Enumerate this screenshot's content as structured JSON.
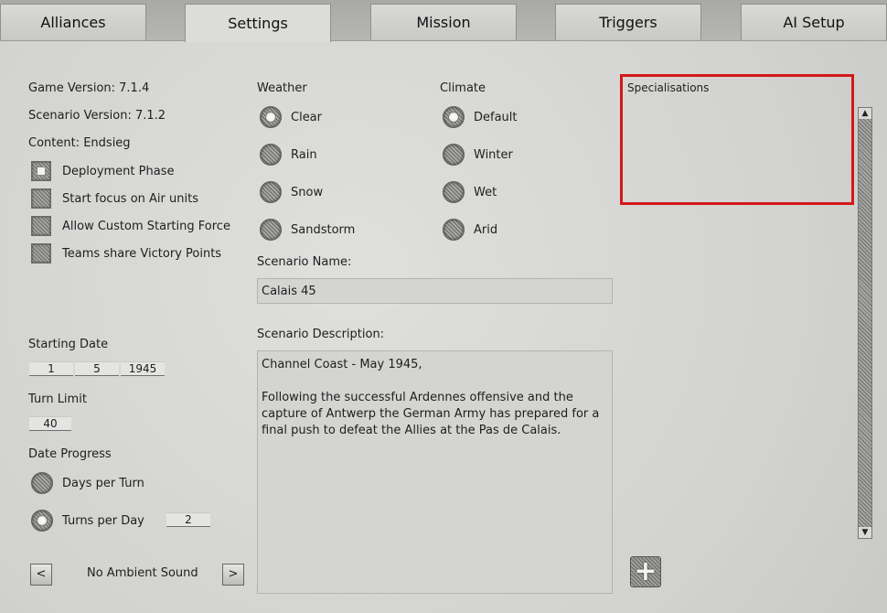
{
  "tabs": [
    {
      "label": "Alliances"
    },
    {
      "label": "Settings"
    },
    {
      "label": "Mission"
    },
    {
      "label": "Triggers"
    },
    {
      "label": "AI Setup"
    }
  ],
  "info": {
    "game_version": "Game Version: 7.1.4",
    "scenario_version": "Scenario Version: 7.1.2",
    "content": "Content: Endsieg"
  },
  "options": [
    {
      "label": "Deployment Phase",
      "checked": true
    },
    {
      "label": "Start focus on Air units",
      "checked": false
    },
    {
      "label": "Allow Custom Starting Force",
      "checked": false
    },
    {
      "label": "Teams share Victory Points",
      "checked": false
    }
  ],
  "starting_date": {
    "label": "Starting Date",
    "day": "1",
    "month": "5",
    "year": "1945"
  },
  "turn_limit": {
    "label": "Turn Limit",
    "value": "40"
  },
  "date_progress": {
    "label": "Date Progress",
    "days_per_turn": "Days per Turn",
    "turns_per_day": "Turns per Day",
    "turns_value": "2",
    "selected": "turns_per_day"
  },
  "ambient": {
    "prev": "<",
    "label": "No Ambient Sound",
    "next": ">"
  },
  "weather": {
    "label": "Weather",
    "options": [
      "Clear",
      "Rain",
      "Snow",
      "Sandstorm"
    ],
    "selected": "Clear"
  },
  "climate": {
    "label": "Climate",
    "options": [
      "Default",
      "Winter",
      "Wet",
      "Arid"
    ],
    "selected": "Default"
  },
  "scenario": {
    "name_label": "Scenario Name:",
    "name": "Calais 45",
    "desc_label": "Scenario Description:",
    "desc_line1": "Channel Coast - May 1945,",
    "desc_line2": "Following the successful Ardennes offensive and the capture of Antwerp the German Army has prepared for a final push to defeat the Allies at the Pas de Calais."
  },
  "specialisations": {
    "label": "Specialisations"
  },
  "colors": {
    "highlight": "#d31818",
    "panel": "#d8d8d6"
  }
}
